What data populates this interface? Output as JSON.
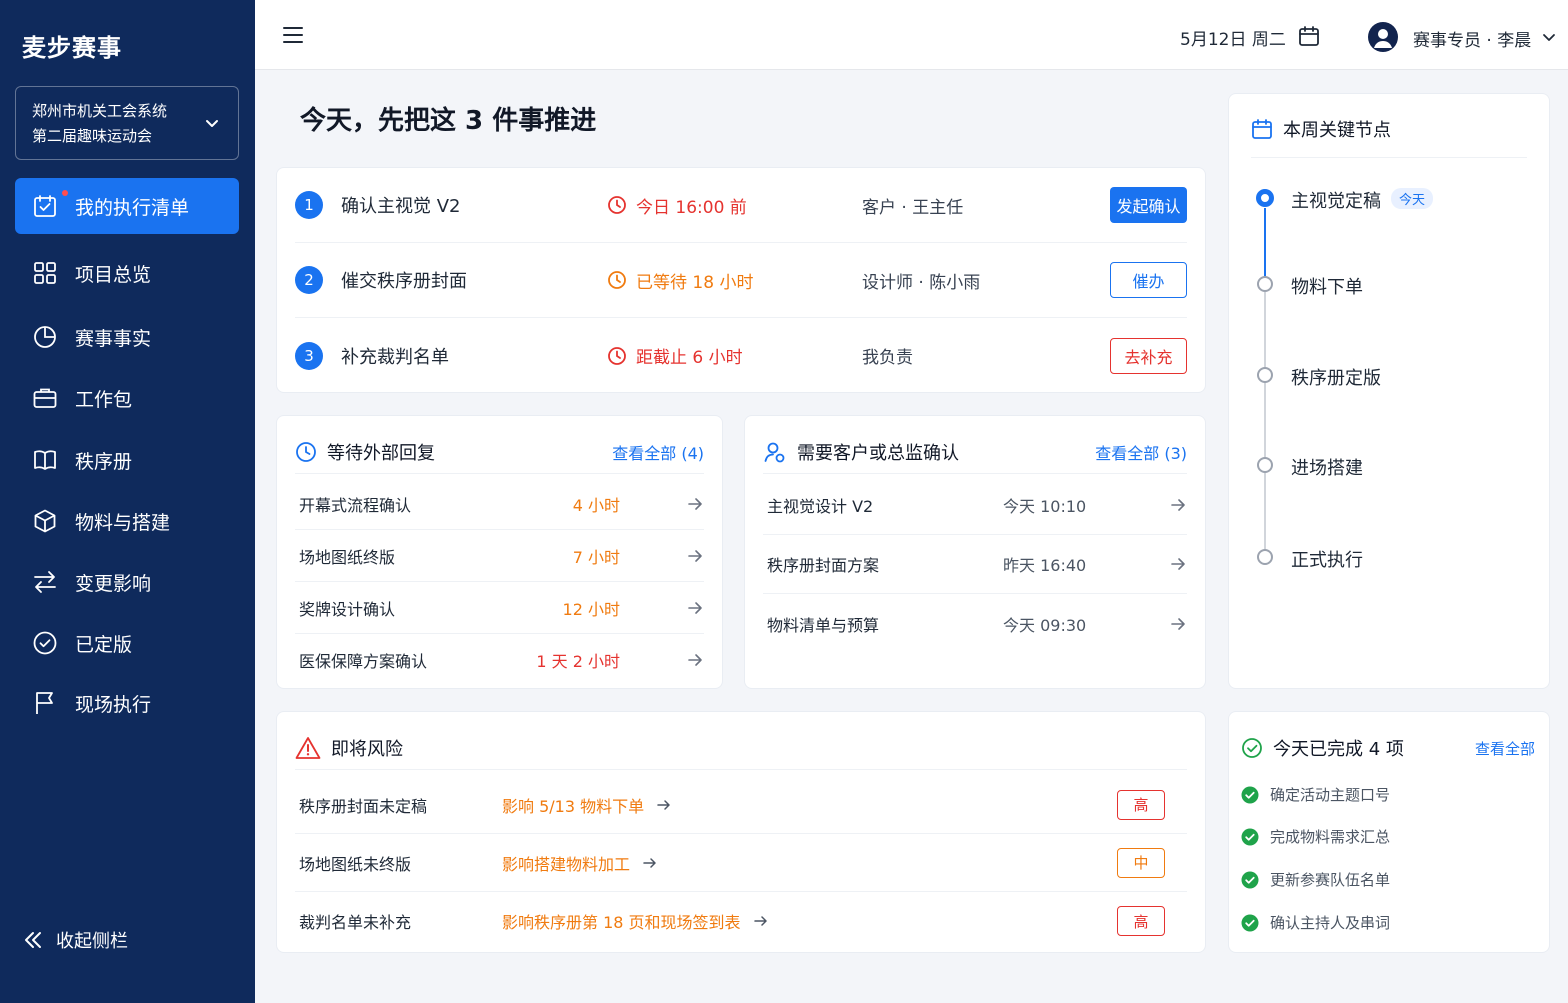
{
  "sidebar": {
    "brand": "麦步赛事",
    "project_line1": "郑州市机关工会系统",
    "project_line2": "第二届趣味运动会",
    "items": [
      {
        "label": "我的执行清单",
        "icon": "calendar-check-icon",
        "active": true
      },
      {
        "label": "项目总览",
        "icon": "grid-icon"
      },
      {
        "label": "赛事事实",
        "icon": "pie-chart-icon"
      },
      {
        "label": "工作包",
        "icon": "briefcase-icon"
      },
      {
        "label": "秩序册",
        "icon": "book-icon"
      },
      {
        "label": "物料与搭建",
        "icon": "box-icon"
      },
      {
        "label": "变更影响",
        "icon": "swap-icon"
      },
      {
        "label": "已定版",
        "icon": "check-circle-icon"
      },
      {
        "label": "现场执行",
        "icon": "flag-icon"
      }
    ],
    "collapse_label": "收起侧栏"
  },
  "header": {
    "date": "5月12日 周二",
    "user": "赛事专员 · 李晨"
  },
  "main": {
    "title": "今天，先把这 3 件事推进",
    "tasks": [
      {
        "num": "1",
        "title": "确认主视觉 V2",
        "time": "今日 16:00 前",
        "time_color": "#e5332f",
        "owner": "客户 · 王主任",
        "action": "发起确认"
      },
      {
        "num": "2",
        "title": "催交秩序册封面",
        "time": "已等待 18 小时",
        "time_color": "#f07b10",
        "owner": "设计师 · 陈小雨",
        "action": "催办"
      },
      {
        "num": "3",
        "title": "补充裁判名单",
        "time": "距截止 6 小时",
        "time_color": "#e5332f",
        "owner": "我负责",
        "action": "去补充"
      }
    ],
    "waiting": {
      "title": "等待外部回复",
      "more": "查看全部 (4)",
      "rows": [
        {
          "name": "开幕式流程确认",
          "wait": "4 小时"
        },
        {
          "name": "场地图纸终版",
          "wait": "7 小时"
        },
        {
          "name": "奖牌设计确认",
          "wait": "12 小时"
        },
        {
          "name": "医保保障方案确认",
          "wait": "1 天 2 小时"
        }
      ]
    },
    "confirm": {
      "title": "需要客户或总监确认",
      "more": "查看全部 (3)",
      "rows": [
        {
          "name": "主视觉设计 V2",
          "time": "今天 10:10"
        },
        {
          "name": "秩序册封面方案",
          "time": "昨天 16:40"
        },
        {
          "name": "物料清单与预算",
          "time": "今天 09:30"
        }
      ]
    },
    "risks": {
      "title": "即将风险",
      "rows": [
        {
          "name": "秩序册封面未定稿",
          "impact": "影响 5/13 物料下单",
          "level": "高"
        },
        {
          "name": "场地图纸未终版",
          "impact": "影响搭建物料加工",
          "level": "中"
        },
        {
          "name": "裁判名单未补充",
          "impact": "影响秩序册第 18 页和现场签到表",
          "level": "高"
        }
      ]
    }
  },
  "milestones": {
    "title": "本周关键节点",
    "today_tag": "今天",
    "items": [
      {
        "label": "主视觉定稿",
        "state": "current"
      },
      {
        "label": "物料下单",
        "state": "todo"
      },
      {
        "label": "秩序册定版",
        "state": "todo"
      },
      {
        "label": "进场搭建",
        "state": "todo"
      },
      {
        "label": "正式执行",
        "state": "todo"
      }
    ]
  },
  "done_today": {
    "title": "今天已完成 4 项",
    "more": "查看全部",
    "items": [
      "确定活动主题口号",
      "完成物料需求汇总",
      "更新参赛队伍名单",
      "确认主持人及串词"
    ]
  },
  "colors": {
    "sidebar": "#0f2a5c",
    "accent": "#1a73f0",
    "danger": "#e5332f",
    "warning": "#f07b10",
    "success": "#1fa34a"
  }
}
